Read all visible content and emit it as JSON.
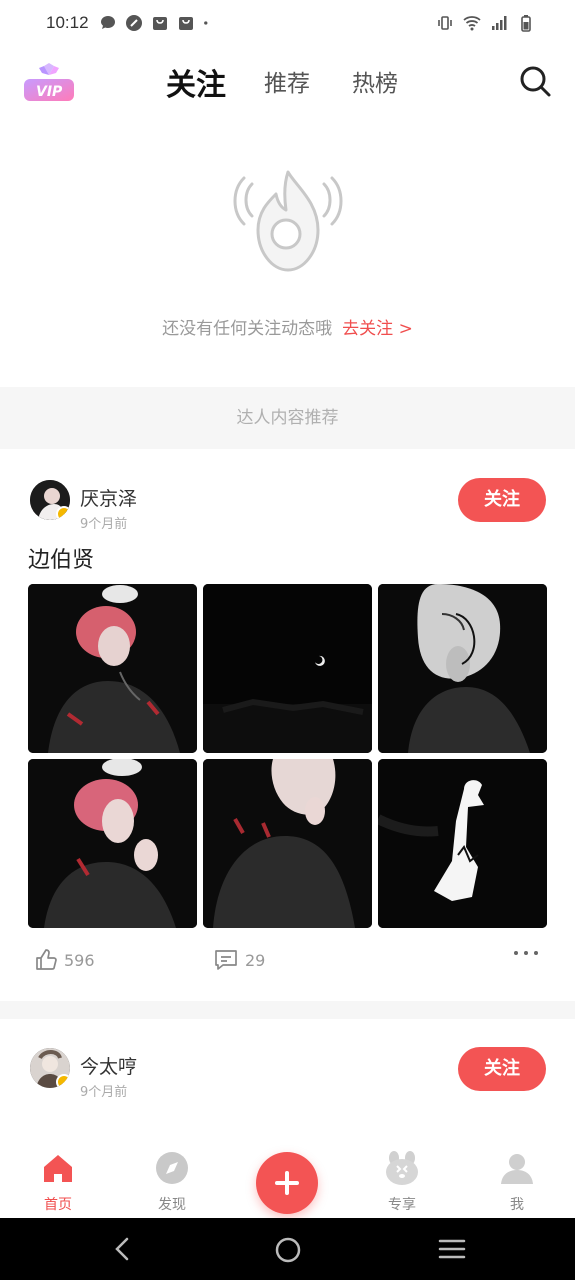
{
  "status_bar": {
    "time": "10:12"
  },
  "top_nav": {
    "vip_label": "VIP",
    "tabs": [
      {
        "label": "关注",
        "active": true
      },
      {
        "label": "推荐",
        "active": false
      },
      {
        "label": "热榜",
        "active": false
      }
    ]
  },
  "empty_state": {
    "message": "还没有任何关注动态哦",
    "action": "去关注 >"
  },
  "recommend_header": "达人内容推荐",
  "posts": [
    {
      "author": "厌京泽",
      "time": "9个月前",
      "follow_label": "关注",
      "title": "边伯贤",
      "likes": "596",
      "comments": "29"
    },
    {
      "author": "今太哼",
      "time": "9个月前",
      "follow_label": "关注"
    }
  ],
  "bottom_nav": {
    "items": [
      {
        "label": "首页",
        "icon": "home-icon",
        "active": true
      },
      {
        "label": "发现",
        "icon": "compass-icon",
        "active": false
      },
      {
        "label": "",
        "icon": "plus-icon",
        "active": false
      },
      {
        "label": "专享",
        "icon": "bunny-icon",
        "active": false
      },
      {
        "label": "我",
        "icon": "user-icon",
        "active": false
      }
    ]
  },
  "colors": {
    "accent": "#f35454",
    "text": "#222222",
    "muted": "#999999"
  }
}
